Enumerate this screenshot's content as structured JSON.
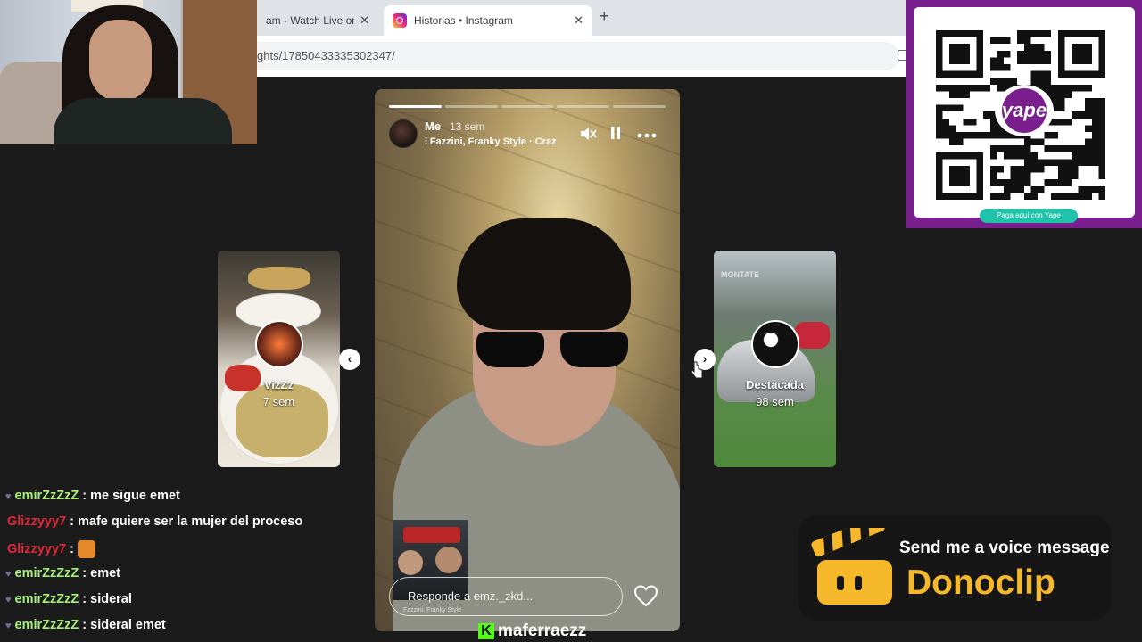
{
  "browser": {
    "tabs": [
      {
        "label": "am - Watch Live on",
        "close": "✕",
        "active": false
      },
      {
        "label": "Historias • Instagram",
        "close": "✕",
        "active": true
      }
    ],
    "new_tab": "+",
    "url": "ghts/17850433335302347/"
  },
  "story": {
    "username": "Me",
    "time_ago": "13 sem",
    "music": "Fazzini, Franky Style · Craz",
    "progress_segments": [
      true,
      false,
      false,
      false,
      false
    ],
    "reply_placeholder": "Responde a emz._zkd...",
    "mini_caption": "Fazzini, Franky Style"
  },
  "side_stories": [
    {
      "name": "VizZz",
      "time": "7 sem"
    },
    {
      "name": "Destacada",
      "time": "98 sem",
      "overlay": "MONTATE"
    }
  ],
  "nav": {
    "prev": "‹",
    "next": "›"
  },
  "qr": {
    "brand": "yape",
    "pill": "Paga aquí con Yape",
    "colors": {
      "panel": "#7a1f8e",
      "pill": "#1fc3a9"
    }
  },
  "chat": [
    {
      "user": "emirZzZzZ",
      "color": "#a7f07c",
      "heart": true,
      "msg": "me sigue emet"
    },
    {
      "user": "Glizzyyy7",
      "color": "#e0283a",
      "heart": false,
      "msg": "mafe quiere ser la mujer del proceso"
    },
    {
      "user": "Glizzyyy7",
      "color": "#e0283a",
      "heart": false,
      "msg": "",
      "emote": true
    },
    {
      "user": "emirZzZzZ",
      "color": "#a7f07c",
      "heart": true,
      "msg": "emet"
    },
    {
      "user": "emirZzZzZ",
      "color": "#a7f07c",
      "heart": true,
      "msg": "sideral"
    },
    {
      "user": "emirZzZzZ",
      "color": "#a7f07c",
      "heart": true,
      "msg": "sideral emet"
    }
  ],
  "donoclip": {
    "tagline": "Send me a voice message",
    "brand": "Donoclip",
    "colors": {
      "brand": "#f4b82a"
    }
  },
  "streamer": {
    "platform_icon": "kick-icon",
    "name": "maferraezz",
    "colors": {
      "accent": "#53fc18"
    }
  }
}
